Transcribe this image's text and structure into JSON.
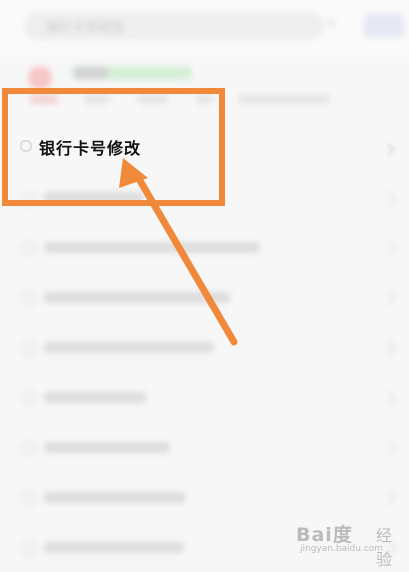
{
  "search": {
    "placeholder": "银行卡号修改",
    "button_label": "搜索"
  },
  "featured_item": {
    "label": "银行卡号修改"
  },
  "colors": {
    "highlight": "#f08a3a",
    "arrow": "#f08a3a"
  },
  "icons": {
    "close": "close-icon",
    "chevron": "chevron-right-icon",
    "watermark": "paw-icon"
  },
  "watermark": {
    "brand": "Bai度",
    "jingyan": "经验",
    "url": "jingyan.baidu.com"
  }
}
